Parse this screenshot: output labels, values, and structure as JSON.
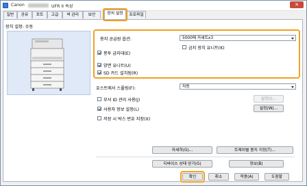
{
  "window": {
    "title_prefix": "Canon",
    "title_suffix": "UFR II 속성",
    "close_label": "✕"
  },
  "tabs": [
    {
      "label": "일반"
    },
    {
      "label": "공유"
    },
    {
      "label": "포트"
    },
    {
      "label": "고급"
    },
    {
      "label": "색 관리"
    },
    {
      "label": "보안"
    },
    {
      "label": "장치 설정"
    },
    {
      "label": "프로파일"
    }
  ],
  "active_tab": "장치 설정",
  "device_settings": {
    "header": "장치 설정: 수동",
    "paper_source_label": "용지 공급원 옵션:",
    "paper_source_value": "5000매 카세트x3",
    "options": {
      "inner_output_tray": "금지 장치 유니트(K)",
      "finisher": "봉투 급지대(E)",
      "duplex_unit": "양면 유니트(U)",
      "sd_card": "SD 카드 설치됨(R)"
    },
    "spooling_label": "호스트에서 스풀링(F):",
    "spooling_value": "자동",
    "dept_id_label": "부서 ID 관리 사용(J)",
    "dept_id_settings_button": "설정(I)...",
    "user_info_label": "사용자 정보 설정(L)",
    "user_info_settings_button": "설정(W)...",
    "user_box_label": "저장 시 박스 번호 지정(X)",
    "details_button": "자세히(G)...",
    "tray_settings_button": "트레이별 용지 지정(T)...",
    "get_device_status_button": "디바이스 상태 얻기(G)",
    "info_button": "정보(B)"
  },
  "footer": {
    "ok": "확인",
    "cancel": "취소",
    "apply": "적용(A)",
    "help": "도움말"
  },
  "checkbox_states": {
    "inner_output_tray": false,
    "finisher": true,
    "duplex_unit": true,
    "sd_card": true,
    "dept_id": false,
    "user_info": true,
    "user_box": false
  },
  "colors": {
    "highlight": "#f0a020",
    "preview_bg": "#dfe9f7"
  }
}
